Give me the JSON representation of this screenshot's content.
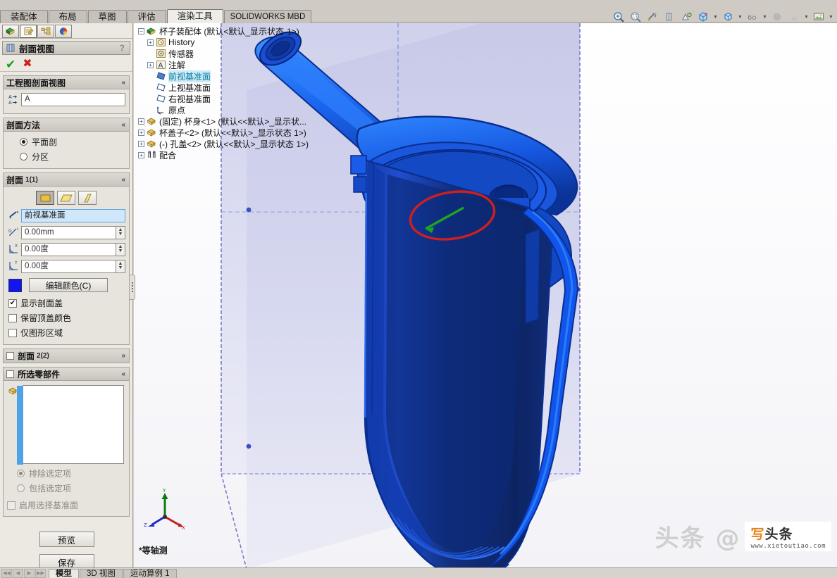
{
  "ribbon": {
    "tabs": [
      {
        "label": "装配体",
        "active": false
      },
      {
        "label": "布局",
        "active": false
      },
      {
        "label": "草图",
        "active": false
      },
      {
        "label": "评估",
        "active": false
      },
      {
        "label": "渲染工具",
        "active": true
      },
      {
        "label": "SOLIDWORKS MBD",
        "active": false
      }
    ]
  },
  "view_toolbar": {
    "items": [
      {
        "name": "zoom-to-fit-icon"
      },
      {
        "name": "zoom-to-area-icon"
      },
      {
        "name": "previous-view-icon"
      },
      {
        "name": "section-view-icon"
      },
      {
        "name": "view-orientation-icon"
      },
      {
        "name": "display-style-icon"
      },
      {
        "name": "hide-show-items-icon"
      },
      {
        "name": "edit-appearance-icon"
      },
      {
        "name": "apply-scene-icon"
      },
      {
        "name": "view-settings-icon"
      }
    ]
  },
  "property_manager": {
    "tabs": [
      {
        "name": "feature-manager-tab",
        "label": "FeatureManager"
      },
      {
        "name": "property-manager-tab",
        "label": "PropertyManager"
      },
      {
        "name": "configuration-manager-tab",
        "label": "ConfigurationManager"
      },
      {
        "name": "display-manager-tab",
        "label": "DisplayManager"
      }
    ],
    "title": "剖面视图",
    "help_glyph": "?",
    "ok_label": "确定",
    "cancel_label": "取消",
    "groups": {
      "drawing_section": {
        "title": "工程图剖面视图",
        "chevron": "«",
        "label_value": "A"
      },
      "section_method": {
        "title": "剖面方法",
        "chevron": "«",
        "options": [
          {
            "label": "平面剖",
            "selected": true
          },
          {
            "label": "分区",
            "selected": false
          }
        ]
      },
      "section1": {
        "title": "剖面",
        "subtitle": "1(1)",
        "chevron": "«",
        "plane_types": [
          {
            "name": "front-plane-type",
            "active": true
          },
          {
            "name": "top-plane-type",
            "active": false
          },
          {
            "name": "right-plane-type",
            "active": false
          }
        ],
        "reference_plane": "前视基准面",
        "offset_distance": "0.00mm",
        "rotation_x": "0.00度",
        "rotation_y": "0.00度",
        "color_swatch": "#1414f0",
        "edit_color_label": "编辑颜色(C)",
        "checkboxes": [
          {
            "label": "显示剖面盖",
            "checked": true,
            "disabled": false
          },
          {
            "label": "保留顶盖颜色",
            "checked": false,
            "disabled": false
          },
          {
            "label": "仅图形区域",
            "checked": false,
            "disabled": false
          }
        ]
      },
      "section2": {
        "title": "剖面",
        "subtitle": "2(2)",
        "chevron": "»",
        "checked": false
      },
      "selected_components": {
        "title": "所选零部件",
        "chevron": "«",
        "checked": false,
        "list_items": [],
        "radios": [
          {
            "label": "排除选定项",
            "selected": true,
            "disabled": true
          },
          {
            "label": "包括选定项",
            "selected": false,
            "disabled": true
          }
        ],
        "checkbox": {
          "label": "启用选择基准面",
          "checked": false,
          "disabled": true
        }
      }
    },
    "buttons": [
      {
        "name": "preview-button",
        "label": "预览"
      },
      {
        "name": "save-button",
        "label": "保存"
      }
    ]
  },
  "feature_tree": {
    "nodes": [
      {
        "label": "杯子装配体  (默认<默认_显示状态-1>)",
        "icon": "assembly-icon",
        "expander": "-",
        "indent": 0,
        "highlight": false
      },
      {
        "label": "History",
        "icon": "history-icon",
        "expander": "+",
        "indent": 1,
        "highlight": false
      },
      {
        "label": "传感器",
        "icon": "sensor-icon",
        "expander": "",
        "indent": 1,
        "highlight": false
      },
      {
        "label": "注解",
        "icon": "annotation-icon",
        "expander": "+",
        "indent": 1,
        "highlight": false
      },
      {
        "label": "前视基准面",
        "icon": "plane-icon",
        "expander": "",
        "indent": 1,
        "highlight": true
      },
      {
        "label": "上视基准面",
        "icon": "plane-icon",
        "expander": "",
        "indent": 1,
        "highlight": false
      },
      {
        "label": "右视基准面",
        "icon": "plane-icon",
        "expander": "",
        "indent": 1,
        "highlight": false
      },
      {
        "label": "原点",
        "icon": "origin-icon",
        "expander": "",
        "indent": 1,
        "highlight": false
      },
      {
        "label": "(固定) 杯身<1> (默认<<默认>_显示状...",
        "icon": "component-icon",
        "expander": "+",
        "indent": 0,
        "highlight": false
      },
      {
        "label": "杯盖子<2> (默认<<默认>_显示状态 1>)",
        "icon": "component-icon",
        "expander": "+",
        "indent": 0,
        "highlight": false
      },
      {
        "label": "(-) 孔盖<2> (默认<<默认>_显示状态 1>)",
        "icon": "component-icon",
        "expander": "+",
        "indent": 0,
        "highlight": false
      },
      {
        "label": "配合",
        "icon": "mates-icon",
        "expander": "+",
        "indent": 0,
        "highlight": false
      }
    ]
  },
  "graphics": {
    "view_label": "*等轴测",
    "triad": {
      "x": "X",
      "y": "Y",
      "z": "Z"
    },
    "watermark": {
      "text": "头条 @",
      "logo_line1_accent": "写",
      "logo_line1": "头条",
      "logo_line2": "www.xietoutiao.com"
    }
  },
  "statusbar": {
    "nav_buttons": [
      "first-record",
      "previous-record",
      "next-record",
      "last-record"
    ],
    "tabs": [
      {
        "label": "模型",
        "active": true
      },
      {
        "label": "3D 视图",
        "active": false
      },
      {
        "label": "运动算例 1",
        "active": false
      }
    ]
  },
  "colors": {
    "model_blue": "#1133cc",
    "section_plane": "#c9cbe8",
    "highlight_cyan": "#cdeaf6",
    "annotation_red": "#d21f1f",
    "annotation_green": "#25a025"
  }
}
